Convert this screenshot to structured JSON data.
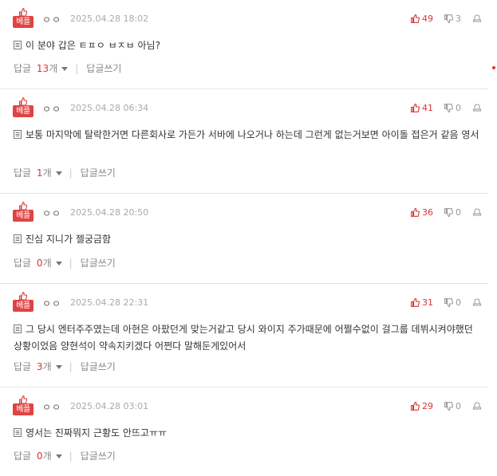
{
  "best_label": "베플",
  "reply_label": "답글",
  "reply_count_unit": "개",
  "write_reply_label": "답글쓰기",
  "comments": [
    {
      "nick": "ㅇㅇ",
      "date": "2025.04.28 18:02",
      "text": "이 분야 갑은 ㅌㅍㅇ ㅂㅈㅂ 아님?",
      "up": "49",
      "down": "3",
      "reply_count": "13"
    },
    {
      "nick": "ㅇㅇ",
      "date": "2025.04.28 06:34",
      "text": "보통 마지막에 탈락한거면 다른회사로 가든가 서바에 나오거나 하는데 그런게 없는거보면 아이돌 접은거 같음 영서",
      "up": "41",
      "down": "0",
      "reply_count": "1"
    },
    {
      "nick": "ㅇㅇ",
      "date": "2025.04.28 20:50",
      "text": "진심 지니가 젤궁금함",
      "up": "36",
      "down": "0",
      "reply_count": "0"
    },
    {
      "nick": "ㅇㅇ",
      "date": "2025.04.28 22:31",
      "text": "그 당시 엔터주주였는데 아현은 아팠던게 맞는거같고 당시 와이지 주가때문에 어쩔수없이 걸그룹 데뷔시켜야했던 상황이었음 양현석이 약속지키겠다 어쩐다 말해둔게있어서",
      "up": "31",
      "down": "0",
      "reply_count": "3"
    },
    {
      "nick": "ㅇㅇ",
      "date": "2025.04.28 03:01",
      "text": "영서는 진짜뭐지 근황도 안뜨고ㅠㅠ",
      "up": "29",
      "down": "0",
      "reply_count": "0"
    }
  ]
}
